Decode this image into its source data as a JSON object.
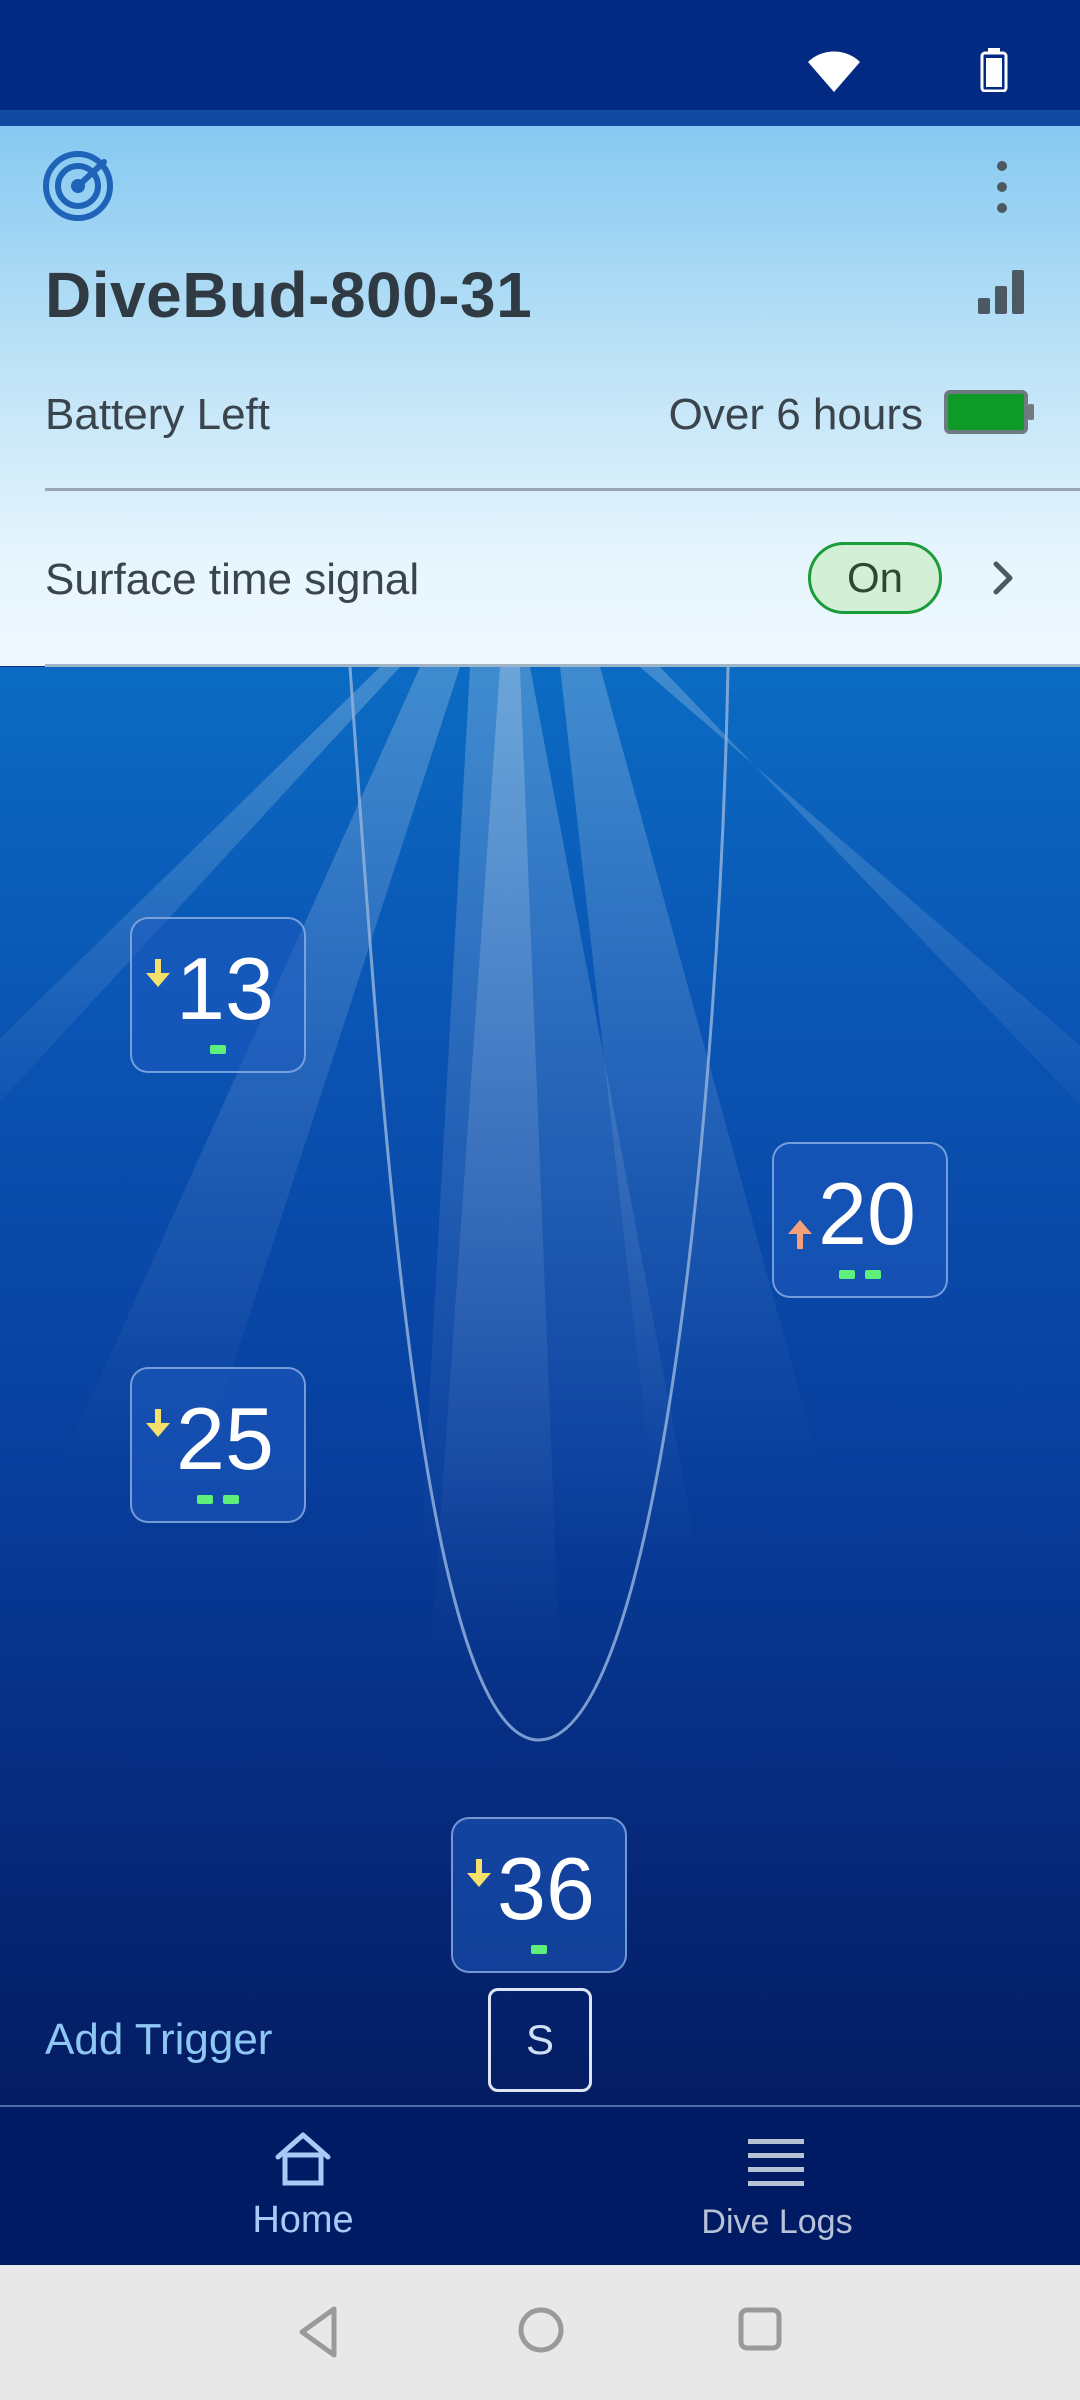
{
  "device": {
    "name": "DiveBud-800-31",
    "battery_label": "Battery Left",
    "battery_value": "Over 6 hours"
  },
  "surface_signal": {
    "label": "Surface time signal",
    "toggle_label": "On"
  },
  "markers": [
    {
      "value": "13",
      "direction": "down",
      "dots": 1
    },
    {
      "value": "20",
      "direction": "up",
      "dots": 2
    },
    {
      "value": "25",
      "direction": "down",
      "dots": 2
    },
    {
      "value": "36",
      "direction": "down",
      "dots": 1
    }
  ],
  "trigger": {
    "label": "Add Trigger",
    "s_button": "S"
  },
  "nav": {
    "home_label": "Home",
    "logs_label": "Dive Logs"
  },
  "colors": {
    "accent_green": "#0e9a26",
    "marker_dot": "#5ef07a",
    "arrow_down": "#f4e06a",
    "arrow_up": "#f4a17a"
  },
  "icons": {
    "status": [
      "wifi-icon",
      "battery-icon"
    ],
    "header": [
      "radar-logo-icon",
      "more-vert-icon",
      "signal-bars-icon"
    ],
    "nav": [
      "home-icon",
      "menu-lines-icon"
    ],
    "system": [
      "back-triangle-icon",
      "home-circle-icon",
      "recent-square-icon"
    ]
  }
}
